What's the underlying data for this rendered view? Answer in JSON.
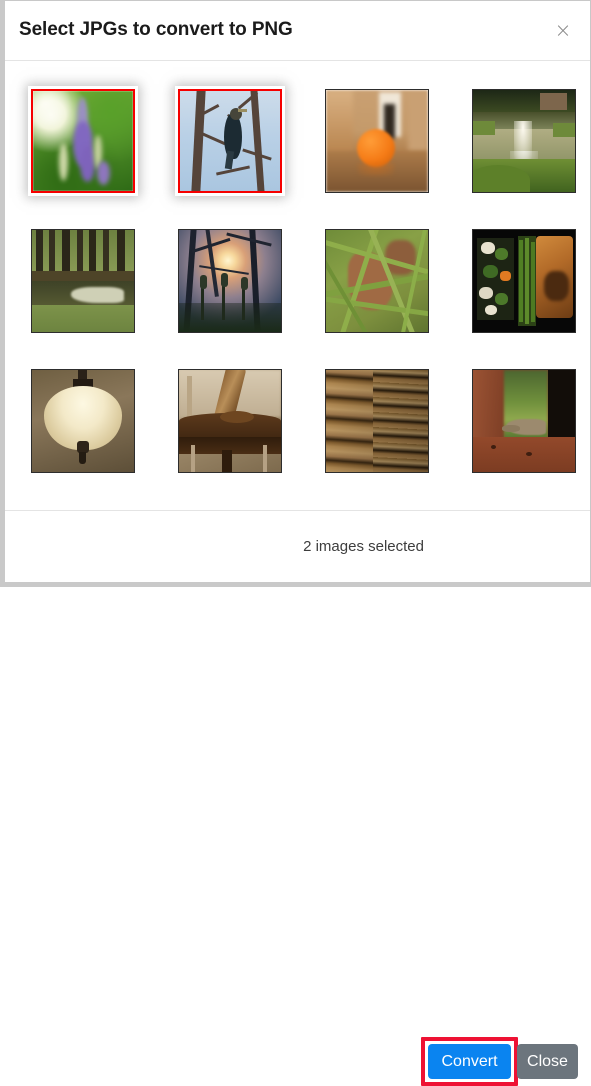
{
  "dialog": {
    "title": "Select JPGs to convert to PNG",
    "close_icon": "close-icon",
    "close_icon_glyph": "×"
  },
  "gallery": {
    "selected_count_label": "2 images selected",
    "thumbnails": [
      {
        "index": 1,
        "subject": "purple flower spike on blurred green foliage",
        "selected": true,
        "row": 1,
        "col": 1
      },
      {
        "index": 2,
        "subject": "dark cormorant bird perched in bare tree branches against blue sky",
        "selected": true,
        "row": 1,
        "col": 2
      },
      {
        "index": 3,
        "subject": "orange fruit on reflective table with warm bokeh background",
        "selected": false,
        "row": 1,
        "col": 3
      },
      {
        "index": 4,
        "subject": "pond fountain with green grass banks and trees",
        "selected": false,
        "row": 1,
        "col": 4
      },
      {
        "index": 5,
        "subject": "dark tree trunks beside muddy pond and grass",
        "selected": false,
        "row": 2,
        "col": 1
      },
      {
        "index": 6,
        "subject": "sunset through tree branches with silhouetted plants",
        "selected": false,
        "row": 2,
        "col": 2
      },
      {
        "index": 7,
        "subject": "close-up of green grass blades over brown dry leaf",
        "selected": false,
        "row": 2,
        "col": 3
      },
      {
        "index": 8,
        "subject": "grilled fish with asparagus and vegetables on dark plate",
        "selected": false,
        "row": 2,
        "col": 4
      },
      {
        "index": 9,
        "subject": "glowing pendant ceiling lamp with cream glass shade",
        "selected": false,
        "row": 3,
        "col": 1
      },
      {
        "index": 10,
        "subject": "close-up of dark wooden chair back joint",
        "selected": false,
        "row": 3,
        "col": 2
      },
      {
        "index": 11,
        "subject": "stack of wooden planks with horizontal stripes",
        "selected": false,
        "row": 3,
        "col": 3
      },
      {
        "index": 12,
        "subject": "lizard on reddish-brown ledge between pillars",
        "selected": false,
        "row": 3,
        "col": 4
      }
    ]
  },
  "footer": {
    "convert_label": "Convert",
    "close_label": "Close"
  },
  "colors": {
    "convert_button": "#0a84f0",
    "close_button": "#6c757d",
    "selection_border": "#f60000",
    "annotation_highlight": "#ee1133",
    "dialog_background": "#ffffff",
    "title_text": "#1b1b1b",
    "divider": "#e4e4e4"
  }
}
